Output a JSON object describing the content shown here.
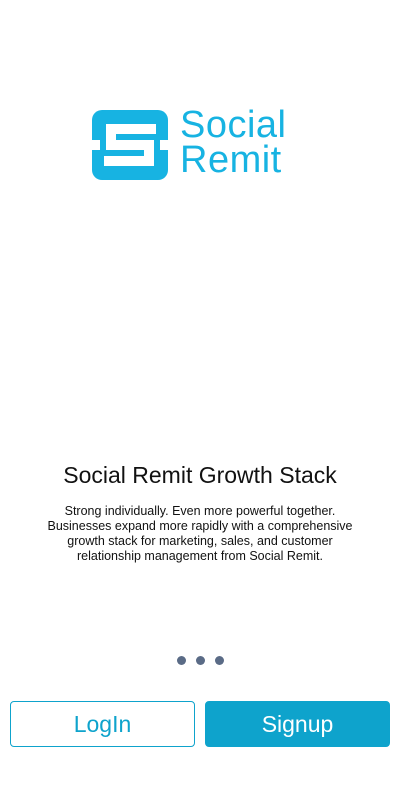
{
  "brand": {
    "name_line1": "Social",
    "name_line2": "Remit",
    "color": "#17b3e2",
    "logo_icon": "s-monogram-icon"
  },
  "onboarding": {
    "title": "Social Remit Growth Stack",
    "description": "Strong individually. Even more powerful together. Businesses expand more rapidly with a comprehensive growth stack for marketing, sales, and customer relationship management from Social Remit."
  },
  "pagination": {
    "dot_count": 3,
    "dot_color": "#5a6b86"
  },
  "actions": {
    "login_label": "LogIn",
    "signup_label": "Signup",
    "accent": "#0ea3cc"
  }
}
